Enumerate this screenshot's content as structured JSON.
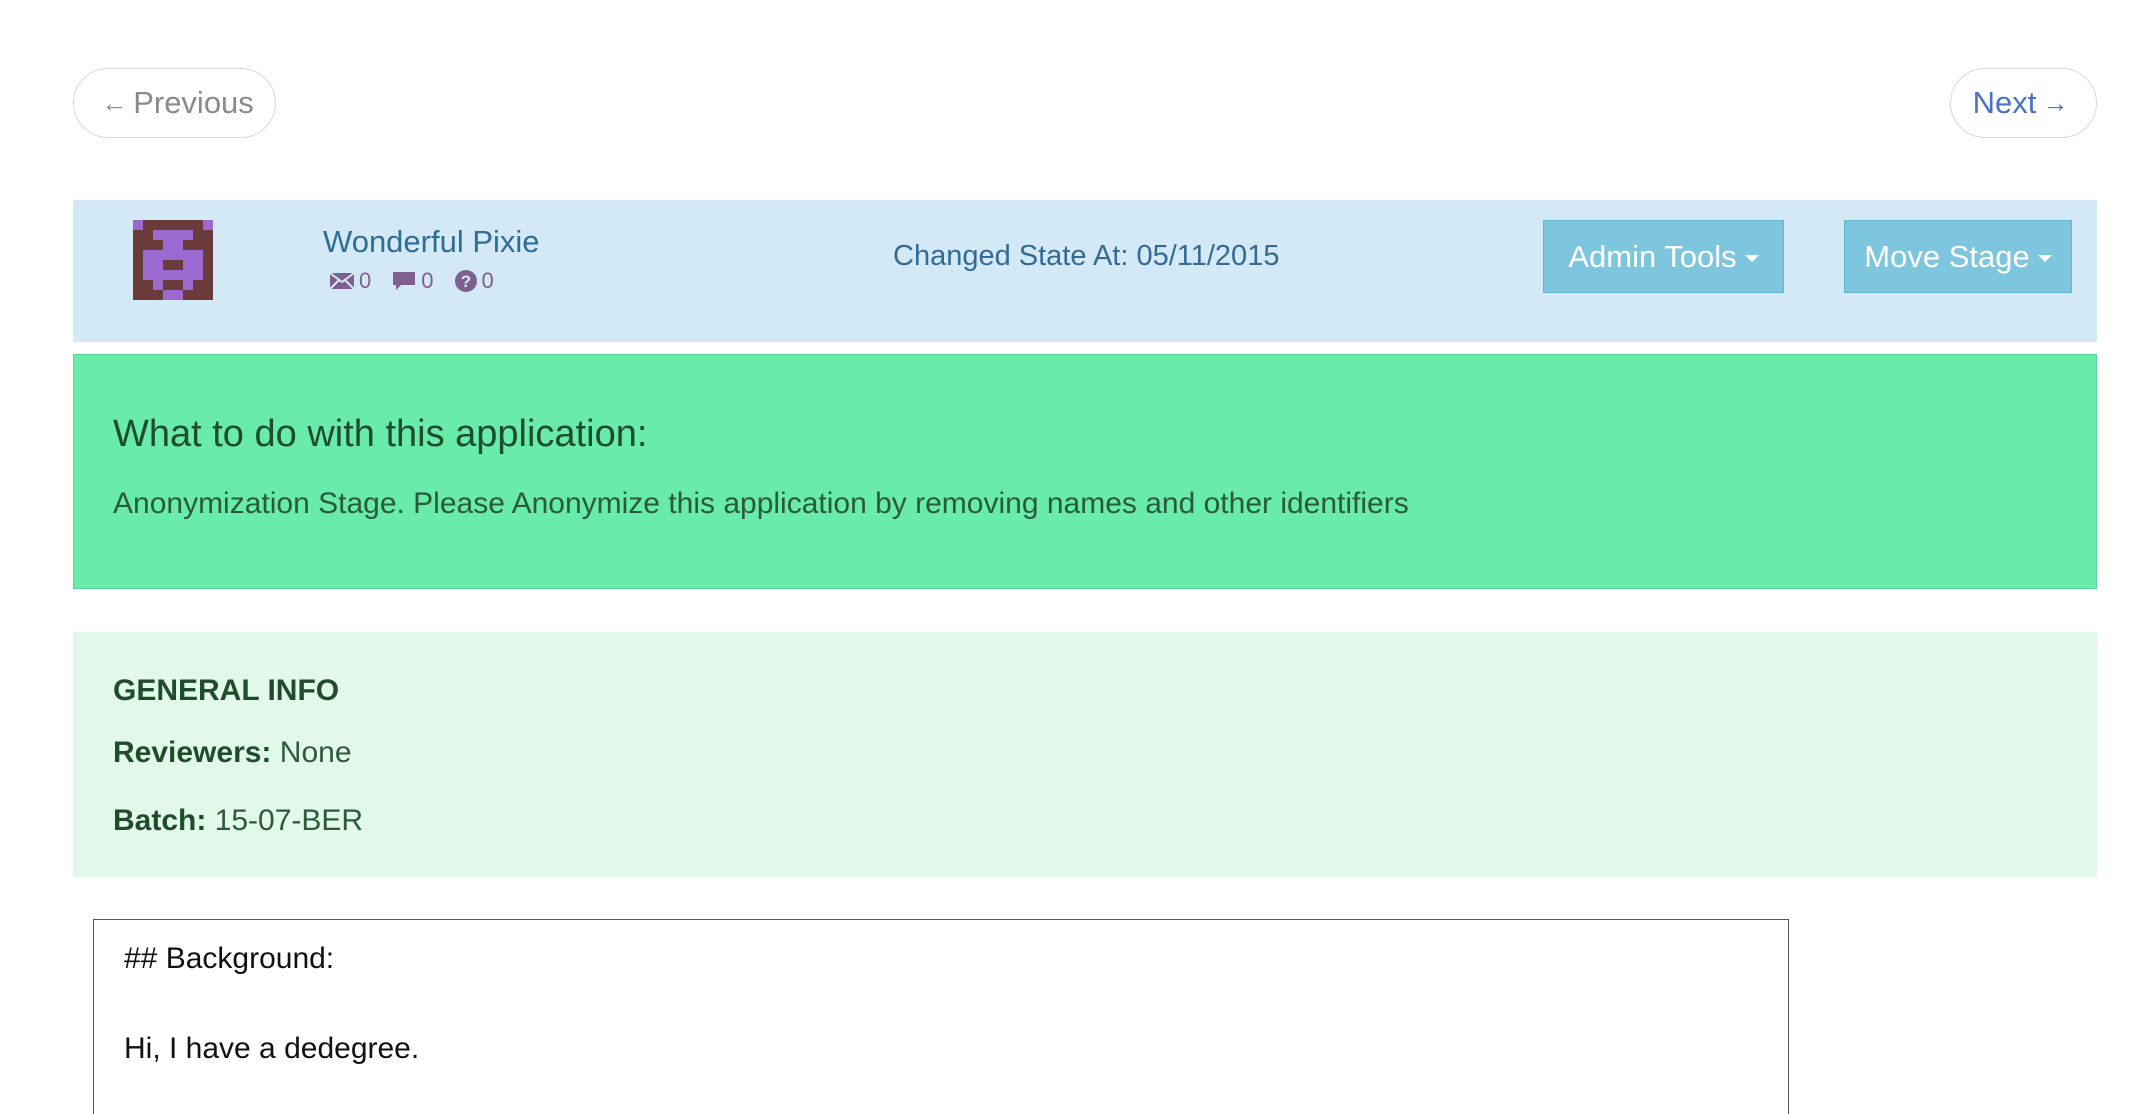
{
  "pager": {
    "previous_label": "Previous",
    "next_label": "Next"
  },
  "header": {
    "applicant_name": "Wonderful Pixie",
    "counters": {
      "messages": "0",
      "comments": "0",
      "questions": "0"
    },
    "changed_state": "Changed State At: 05/11/2015",
    "admin_tools_label": "Admin Tools",
    "move_stage_label": "Move Stage"
  },
  "instructions": {
    "heading": "What to do with this application:",
    "text": "Anonymization Stage. Please Anonymize this application by removing names and other identifiers"
  },
  "general_info": {
    "title": "GENERAL INFO",
    "reviewers_label": "Reviewers:",
    "reviewers_value": "None",
    "batch_label": "Batch:",
    "batch_value": "15-07-BER"
  },
  "application_text": "## Background:\n\nHi, I have a dedegree.",
  "colors": {
    "header_bg": "#d3e9f5",
    "instruction_bg": "#69eba9",
    "general_info_bg": "#e1f8ea",
    "dropdown_bg": "#7ec6de",
    "avatar_dark": "#6b3a3a",
    "avatar_light": "#9b6ad0"
  }
}
